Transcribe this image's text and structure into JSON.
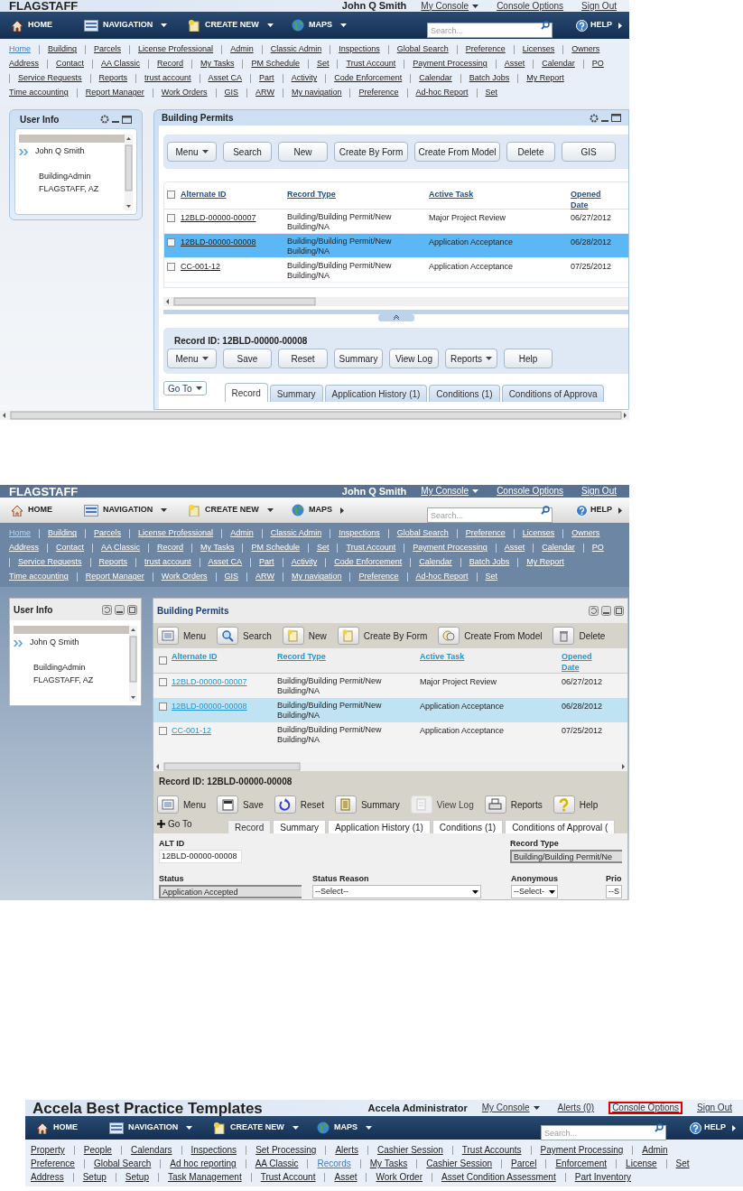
{
  "screens": [
    {
      "kind": "blue",
      "header": {
        "title": "FLAGSTAFF",
        "items": [
          {
            "label": "John Q Smith",
            "kind": "user"
          },
          {
            "label": "My Console",
            "kind": "menu"
          },
          {
            "label": "Console Options",
            "kind": "link"
          },
          {
            "label": "Sign Out",
            "kind": "link"
          }
        ]
      },
      "nav": {
        "items": [
          {
            "label": "HOME",
            "kind": "home",
            "dropdown": false,
            "flyout": false
          },
          {
            "label": "NAVIGATION",
            "kind": "navigation",
            "dropdown": true,
            "flyout": false
          },
          {
            "label": "CREATE NEW",
            "kind": "create",
            "dropdown": true,
            "flyout": false
          },
          {
            "label": "MAPS",
            "kind": "maps",
            "dropdown": true,
            "flyout": false
          }
        ],
        "search_placeholder": "Search...",
        "help": {
          "label": "HELP",
          "flyout": true
        }
      },
      "links": [
        [
          {
            "label": "Home",
            "selected": true
          },
          {
            "label": "Building",
            "selected": false
          },
          {
            "label": "Parcels",
            "selected": false
          },
          {
            "label": "License Professional",
            "selected": false
          },
          {
            "label": "Admin",
            "selected": false
          },
          {
            "label": "Classic Admin",
            "selected": false
          },
          {
            "label": "Inspections",
            "selected": false
          },
          {
            "label": "Global Search",
            "selected": false
          },
          {
            "label": "Preference",
            "selected": false
          },
          {
            "label": "Licenses",
            "selected": false
          },
          {
            "label": "Owners",
            "selected": false
          }
        ],
        [
          {
            "label": "Address",
            "selected": false
          },
          {
            "label": "Contact",
            "selected": false
          },
          {
            "label": "AA Classic",
            "selected": false
          },
          {
            "label": "Record",
            "selected": false
          },
          {
            "label": "My Tasks",
            "selected": false
          },
          {
            "label": "PM Schedule",
            "selected": false
          },
          {
            "label": "Set",
            "selected": false
          },
          {
            "label": "Trust Account",
            "selected": false
          },
          {
            "label": "Payment Processing",
            "selected": false
          },
          {
            "label": "Asset",
            "selected": false
          },
          {
            "label": "Calendar",
            "selected": false
          },
          {
            "label": "PO",
            "selected": false
          }
        ],
        [
          {
            "label": "Service Requests",
            "selected": false
          },
          {
            "label": "Reports",
            "selected": false
          },
          {
            "label": "trust account",
            "selected": false
          },
          {
            "label": "Asset CA",
            "selected": false
          },
          {
            "label": "Part",
            "selected": false
          },
          {
            "label": "Activity",
            "selected": false
          },
          {
            "label": "Code Enforcement",
            "selected": false
          },
          {
            "label": "Calendar",
            "selected": false
          },
          {
            "label": "Batch Jobs",
            "selected": false
          },
          {
            "label": "My Report",
            "selected": false
          }
        ],
        [
          {
            "label": "Time accounting",
            "selected": false
          },
          {
            "label": "Report Manager",
            "selected": false
          },
          {
            "label": "Work Orders",
            "selected": false
          },
          {
            "label": "GIS",
            "selected": false
          },
          {
            "label": "ARW",
            "selected": false
          },
          {
            "label": "My navigation",
            "selected": false
          },
          {
            "label": "Preference",
            "selected": false
          },
          {
            "label": "Ad-hoc Report",
            "selected": false
          },
          {
            "label": "Set",
            "selected": false
          }
        ]
      ],
      "user_info": {
        "title": "User Info",
        "name": "John Q Smith",
        "role": "BuildingAdmin",
        "location": "FLAGSTAFF, AZ"
      },
      "permits": {
        "title": "Building Permits",
        "toolbar": [
          {
            "label": "Menu",
            "dropdown": true
          },
          {
            "label": "Search",
            "dropdown": false
          },
          {
            "label": "New",
            "dropdown": false
          },
          {
            "label": "Create By Form",
            "dropdown": false
          },
          {
            "label": "Create From Model",
            "dropdown": false
          },
          {
            "label": "Delete",
            "dropdown": false
          },
          {
            "label": "GIS",
            "dropdown": false
          }
        ],
        "all_checked": false,
        "columns": [
          "Alternate ID",
          "Record Type",
          "Active Task",
          "Opened Date"
        ],
        "rows": [
          {
            "id": "12BLD-00000-00007",
            "type": "Building/Building Permit/New Building/NA",
            "task": "Major Project Review",
            "date": "06/27/2012",
            "checked": false,
            "selected": false
          },
          {
            "id": "12BLD-00000-00008",
            "type": "Building/Building Permit/New Building/NA",
            "task": "Application Acceptance",
            "date": "06/28/2012",
            "checked": false,
            "selected": true
          },
          {
            "id": "CC-001-12",
            "type": "Building/Building Permit/New Building/NA",
            "task": "Application Acceptance",
            "date": "07/25/2012",
            "checked": false,
            "selected": false
          }
        ],
        "record_id": "Record ID: 12BLD-00000-00008",
        "record_buttons": [
          {
            "label": "Menu",
            "dropdown": true
          },
          {
            "label": "Save",
            "dropdown": false
          },
          {
            "label": "Reset",
            "dropdown": false
          },
          {
            "label": "Summary",
            "dropdown": false
          },
          {
            "label": "View Log",
            "dropdown": false
          },
          {
            "label": "Reports",
            "dropdown": true
          },
          {
            "label": "Help",
            "dropdown": false
          }
        ],
        "goto": {
          "label": "Go To",
          "kind": "dropdown"
        },
        "tabs": [
          {
            "label": "Record",
            "selected": true
          },
          {
            "label": "Summary",
            "selected": false
          },
          {
            "label": "Application History (1)",
            "selected": false
          },
          {
            "label": "Conditions (1)",
            "selected": false
          },
          {
            "label": "Conditions of Approva",
            "selected": false
          }
        ]
      }
    },
    {
      "kind": "slate",
      "header": {
        "title": "FLAGSTAFF",
        "items": [
          {
            "label": "John Q Smith",
            "kind": "user"
          },
          {
            "label": "My Console",
            "kind": "menu"
          },
          {
            "label": "Console Options",
            "kind": "link"
          },
          {
            "label": "Sign Out",
            "kind": "link"
          }
        ]
      },
      "nav": {
        "items": [
          {
            "label": "HOME",
            "kind": "home",
            "dropdown": false,
            "flyout": false
          },
          {
            "label": "NAVIGATION",
            "kind": "navigation",
            "dropdown": true,
            "flyout": false
          },
          {
            "label": "CREATE NEW",
            "kind": "create",
            "dropdown": true,
            "flyout": false
          },
          {
            "label": "MAPS",
            "kind": "maps",
            "dropdown": false,
            "flyout": true
          }
        ],
        "search_placeholder": "Search...",
        "help": {
          "label": "HELP",
          "flyout": true
        }
      },
      "links": [
        [
          {
            "label": "Home",
            "selected": true
          },
          {
            "label": "Building",
            "selected": false
          },
          {
            "label": "Parcels",
            "selected": false
          },
          {
            "label": "License Professional",
            "selected": false
          },
          {
            "label": "Admin",
            "selected": false
          },
          {
            "label": "Classic Admin",
            "selected": false
          },
          {
            "label": "Inspections",
            "selected": false
          },
          {
            "label": "Global Search",
            "selected": false
          },
          {
            "label": "Preference",
            "selected": false
          },
          {
            "label": "Licenses",
            "selected": false
          },
          {
            "label": "Owners",
            "selected": false
          }
        ],
        [
          {
            "label": "Address",
            "selected": false
          },
          {
            "label": "Contact",
            "selected": false
          },
          {
            "label": "AA Classic",
            "selected": false
          },
          {
            "label": "Record",
            "selected": false
          },
          {
            "label": "My Tasks",
            "selected": false
          },
          {
            "label": "PM Schedule",
            "selected": false
          },
          {
            "label": "Set",
            "selected": false
          },
          {
            "label": "Trust Account",
            "selected": false
          },
          {
            "label": "Payment Processing",
            "selected": false
          },
          {
            "label": "Asset",
            "selected": false
          },
          {
            "label": "Calendar",
            "selected": false
          },
          {
            "label": "PO",
            "selected": false
          }
        ],
        [
          {
            "label": "Service Requests",
            "selected": false
          },
          {
            "label": "Reports",
            "selected": false
          },
          {
            "label": "trust account",
            "selected": false
          },
          {
            "label": "Asset CA",
            "selected": false
          },
          {
            "label": "Part",
            "selected": false
          },
          {
            "label": "Activity",
            "selected": false
          },
          {
            "label": "Code Enforcement",
            "selected": false
          },
          {
            "label": "Calendar",
            "selected": false
          },
          {
            "label": "Batch Jobs",
            "selected": false
          },
          {
            "label": "My Report",
            "selected": false
          }
        ],
        [
          {
            "label": "Time accounting",
            "selected": false
          },
          {
            "label": "Report Manager",
            "selected": false
          },
          {
            "label": "Work Orders",
            "selected": false
          },
          {
            "label": "GIS",
            "selected": false
          },
          {
            "label": "ARW",
            "selected": false
          },
          {
            "label": "My navigation",
            "selected": false
          },
          {
            "label": "Preference",
            "selected": false
          },
          {
            "label": "Ad-hoc Report",
            "selected": false
          },
          {
            "label": "Set",
            "selected": false
          }
        ]
      ],
      "user_info": {
        "title": "User Info",
        "name": "John Q Smith",
        "role": "BuildingAdmin",
        "location": "FLAGSTAFF, AZ"
      },
      "permits": {
        "title": "Building Permits",
        "toolbar": [
          {
            "label": "Menu",
            "kind": "menu"
          },
          {
            "label": "Search",
            "kind": "search"
          },
          {
            "label": "New",
            "kind": "new"
          },
          {
            "label": "Create By Form",
            "kind": "new"
          },
          {
            "label": "Create From Model",
            "kind": "model"
          },
          {
            "label": "Delete",
            "kind": "delete"
          }
        ],
        "all_checked": false,
        "columns": [
          "Alternate ID",
          "Record Type",
          "Active Task",
          "Opened Date"
        ],
        "rows": [
          {
            "id": "12BLD-00000-00007",
            "type": "Building/Building Permit/New Building/NA",
            "task": "Major Project Review",
            "date": "06/27/2012",
            "checked": false,
            "selected": false
          },
          {
            "id": "12BLD-00000-00008",
            "type": "Building/Building Permit/New Building/NA",
            "task": "Application Acceptance",
            "date": "06/28/2012",
            "checked": false,
            "selected": true
          },
          {
            "id": "CC-001-12",
            "type": "Building/Building Permit/New Building/NA",
            "task": "Application Acceptance",
            "date": "07/25/2012",
            "checked": false,
            "selected": false
          }
        ],
        "record_id": "Record ID: 12BLD-00000-00008",
        "record_buttons": [
          {
            "label": "Menu",
            "kind": "menu",
            "disabled": false
          },
          {
            "label": "Save",
            "kind": "save",
            "disabled": false
          },
          {
            "label": "Reset",
            "kind": "reset",
            "disabled": false
          },
          {
            "label": "Summary",
            "kind": "summary",
            "disabled": false
          },
          {
            "label": "View Log",
            "kind": "log",
            "disabled": true
          },
          {
            "label": "Reports",
            "kind": "print",
            "disabled": false
          },
          {
            "label": "Help",
            "kind": "help",
            "disabled": false
          }
        ],
        "goto": {
          "label": "Go To",
          "kind": "expand"
        },
        "tabs": [
          {
            "label": "Record",
            "selected": true
          },
          {
            "label": "Summary",
            "selected": false
          },
          {
            "label": "Application History (1)",
            "selected": false
          },
          {
            "label": "Conditions (1)",
            "selected": false
          },
          {
            "label": "Conditions of Approval (",
            "selected": false
          }
        ],
        "form": [
          [
            {
              "label": "ALT ID",
              "value": "12BLD-00000-00008",
              "kind": "text"
            },
            {
              "label": "Record Type",
              "value": "Building/Building Permit/Ne",
              "kind": "readonly"
            }
          ],
          [
            {
              "label": "Status",
              "value": "Application Accepted",
              "kind": "readonly"
            },
            {
              "label": "Status Reason",
              "value": "--Select--",
              "kind": "select"
            },
            {
              "label": "Anonymous",
              "value": "--Select-",
              "kind": "select"
            },
            {
              "label": "Prio",
              "value": "--S",
              "kind": "select"
            }
          ]
        ]
      }
    },
    {
      "kind": "blue",
      "header": {
        "title": "Accela Best Practice Templates",
        "items": [
          {
            "label": "Accela Administrator",
            "kind": "user"
          },
          {
            "label": "My Console",
            "kind": "menu",
            "highlighted": false
          },
          {
            "label": "Alerts (0)",
            "kind": "link",
            "highlighted": false
          },
          {
            "label": "Console Options",
            "kind": "link",
            "highlighted": true
          },
          {
            "label": "Sign Out",
            "kind": "link",
            "highlighted": false
          }
        ]
      },
      "nav": {
        "items": [
          {
            "label": "HOME",
            "kind": "home",
            "dropdown": false,
            "flyout": false
          },
          {
            "label": "NAVIGATION",
            "kind": "navigation",
            "dropdown": true,
            "flyout": false
          },
          {
            "label": "CREATE NEW",
            "kind": "create",
            "dropdown": true,
            "flyout": false
          },
          {
            "label": "MAPS",
            "kind": "maps",
            "dropdown": true,
            "flyout": false
          }
        ],
        "search_placeholder": "Search...",
        "help": {
          "label": "HELP",
          "flyout": true
        }
      },
      "links": [
        [
          {
            "label": "Property",
            "selected": false
          },
          {
            "label": "People",
            "selected": false
          },
          {
            "label": "Calendars",
            "selected": false
          },
          {
            "label": "Inspections",
            "selected": false
          },
          {
            "label": "Set Processing",
            "selected": false
          },
          {
            "label": "Alerts",
            "selected": false
          },
          {
            "label": "Cashier Session",
            "selected": false
          },
          {
            "label": "Trust Accounts",
            "selected": false
          },
          {
            "label": "Payment Processing",
            "selected": false
          },
          {
            "label": "Admin",
            "selected": false
          }
        ],
        [
          {
            "label": "Preference",
            "selected": false
          },
          {
            "label": "Global Search",
            "selected": false
          },
          {
            "label": "Ad hoc reporting",
            "selected": false
          },
          {
            "label": "AA Classic",
            "selected": false
          },
          {
            "label": "Records",
            "selected": true
          },
          {
            "label": "My Tasks",
            "selected": false
          },
          {
            "label": "Cashier Session",
            "selected": false
          },
          {
            "label": "Parcel",
            "selected": false
          },
          {
            "label": "Enforcement",
            "selected": false
          },
          {
            "label": "License",
            "selected": false
          },
          {
            "label": "Set",
            "selected": false
          }
        ],
        [
          {
            "label": "Address",
            "selected": false
          },
          {
            "label": "Setup",
            "selected": false
          },
          {
            "label": "Setup",
            "selected": false
          },
          {
            "label": "Task Management",
            "selected": false
          },
          {
            "label": "Trust Account",
            "selected": false
          },
          {
            "label": "Asset",
            "selected": false
          },
          {
            "label": "Work Order",
            "selected": false
          },
          {
            "label": "Asset Condition Assessment",
            "selected": false
          },
          {
            "label": "Part Inventory",
            "selected": false
          }
        ]
      ]
    }
  ]
}
